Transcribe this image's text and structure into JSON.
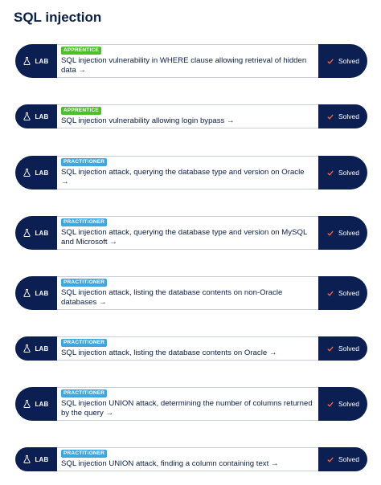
{
  "page": {
    "title": "SQL injection"
  },
  "labs": [
    {
      "tag": "LAB",
      "level": "APPRENTICE",
      "title": "SQL injection vulnerability in WHERE clause allowing retrieval of hidden data →",
      "status": "Solved"
    },
    {
      "tag": "LAB",
      "level": "APPRENTICE",
      "title": "SQL injection vulnerability allowing login bypass →",
      "status": "Solved"
    },
    {
      "tag": "LAB",
      "level": "PRACTITIONER",
      "title": "SQL injection attack, querying the database type and version on Oracle →",
      "status": "Solved"
    },
    {
      "tag": "LAB",
      "level": "PRACTITIONER",
      "title": "SQL injection attack, querying the database type and version on MySQL and Microsoft →",
      "status": "Solved"
    },
    {
      "tag": "LAB",
      "level": "PRACTITIONER",
      "title": "SQL injection attack, listing the database contents on non-Oracle databases →",
      "status": "Solved"
    },
    {
      "tag": "LAB",
      "level": "PRACTITIONER",
      "title": "SQL injection attack, listing the database contents on Oracle →",
      "status": "Solved"
    },
    {
      "tag": "LAB",
      "level": "PRACTITIONER",
      "title": "SQL injection UNION attack, determining the number of columns returned by the query →",
      "status": "Solved"
    },
    {
      "tag": "LAB",
      "level": "PRACTITIONER",
      "title": "SQL injection UNION attack, finding a column containing text →",
      "status": "Solved"
    }
  ],
  "icons": {
    "lab": "flask-icon",
    "status": "check-icon"
  },
  "colors": {
    "navy": "#0c1f52",
    "apprentice": "#4cbf2a",
    "practitioner": "#3fa6e0",
    "check": "#ff6633"
  }
}
